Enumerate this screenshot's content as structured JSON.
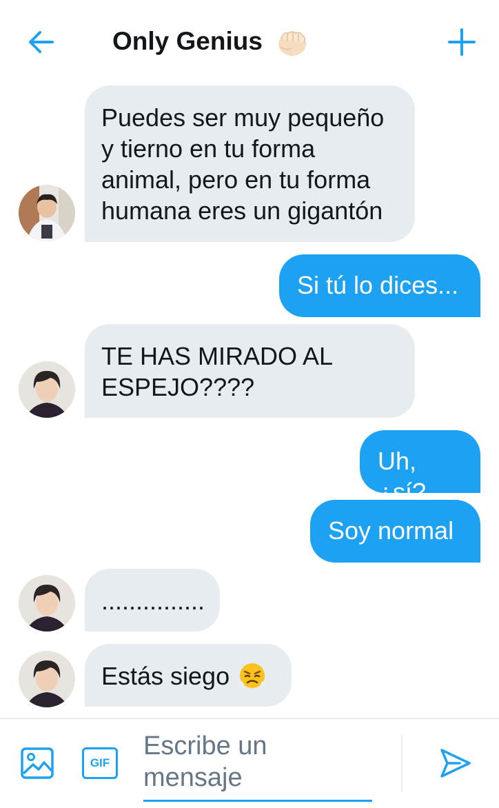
{
  "header": {
    "title": "Only Genius",
    "title_emoji": "raised-fist-emoji",
    "back_icon": "arrow-left-icon",
    "add_icon": "plus-icon"
  },
  "messages": [
    {
      "direction": "incoming",
      "avatar": "user-avatar-1",
      "text": "Puedes ser muy pequeño\ny tierno en tu forma\nanimal, pero en tu forma\nhumana eres un gigantón"
    },
    {
      "direction": "outgoing",
      "text": "Si tú lo dices..."
    },
    {
      "direction": "incoming",
      "avatar": "user-avatar-2",
      "text": "TE HAS MIRADO AL\nESPEJO????"
    },
    {
      "direction": "outgoing",
      "text": "Uh, ¿sí?"
    },
    {
      "direction": "outgoing",
      "text": "Soy normal"
    },
    {
      "direction": "incoming",
      "avatar": "user-avatar-2",
      "text": "..............."
    },
    {
      "direction": "incoming",
      "avatar": "user-avatar-2",
      "text": "Estás siego",
      "emoji": "face-with-steam-emoji"
    }
  ],
  "composer": {
    "media_icon": "image-icon",
    "gif_label": "GIF",
    "placeholder": "Escribe un mensaje",
    "send_icon": "send-icon"
  },
  "colors": {
    "accent": "#1da1f2",
    "incoming_bubble": "#e6ecf0",
    "text": "#14171a",
    "muted": "#657786"
  }
}
